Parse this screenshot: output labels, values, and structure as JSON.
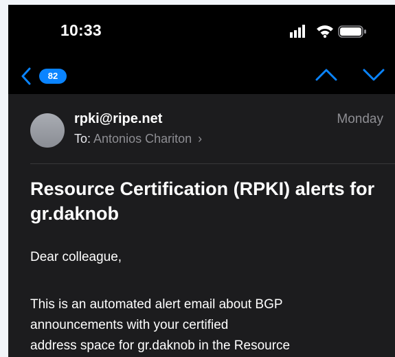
{
  "status_bar": {
    "time": "10:33",
    "icons": [
      "signal-icon",
      "wifi-icon",
      "battery-icon"
    ]
  },
  "nav": {
    "back_icon": "chevron-left-icon",
    "unread_count": "82",
    "up_icon": "chevron-up-icon",
    "down_icon": "chevron-down-icon"
  },
  "message": {
    "sender": "rpki@ripe.net",
    "date": "Monday",
    "to_label": "To:",
    "recipient": "Antonios Chariton",
    "recipient_chevron": "›",
    "subject": "Resource Certification (RPKI) alerts for gr.daknob",
    "greeting": "Dear colleague,",
    "body_lines": [
      "This is an automated alert email about BGP",
      "announcements with your certified",
      "address space for gr.daknob in the Resource"
    ]
  },
  "colors": {
    "accent": "#0a84ff",
    "background": "#000000",
    "content_background": "#1c1c1e",
    "secondary_text": "#8e8e93"
  }
}
